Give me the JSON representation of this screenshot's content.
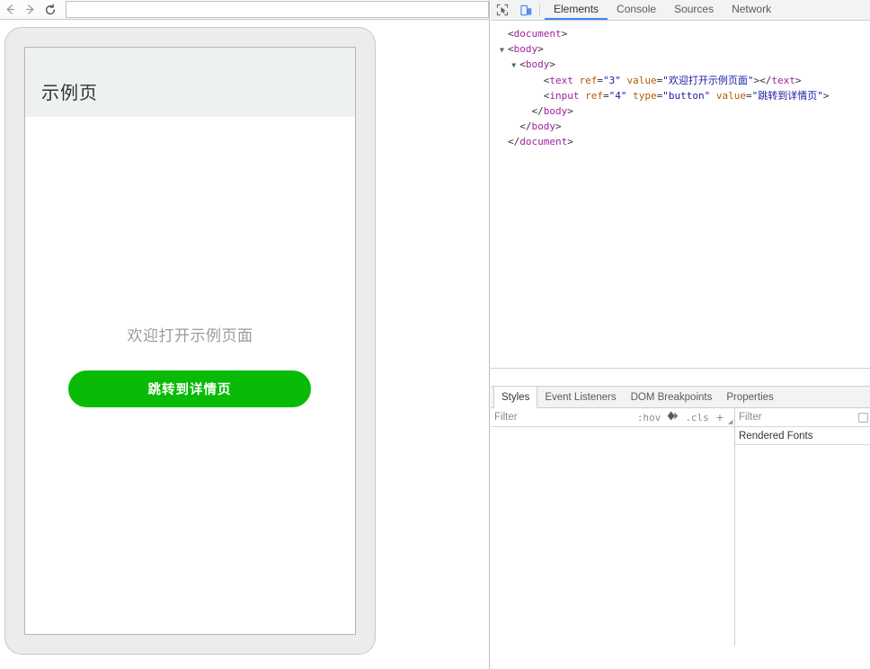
{
  "browser": {
    "nav": {
      "back_icon": "arrow-left-icon",
      "forward_icon": "arrow-right-icon",
      "reload_icon": "reload-icon"
    },
    "address_bar": {
      "value": "",
      "placeholder": ""
    }
  },
  "device_preview": {
    "page": {
      "header_title": "示例页",
      "welcome_text": "欢迎打开示例页面",
      "button_label": "跳转到详情页",
      "button_color": "#09bb07",
      "header_bg": "#edf1ef"
    }
  },
  "devtools": {
    "toolbar": {
      "inspect_icon": "inspect-element-icon",
      "device_toggle_icon": "device-toolbar-icon",
      "device_toggle_color": "#4285f4"
    },
    "tabs": [
      {
        "label": "Elements",
        "selected": true
      },
      {
        "label": "Console",
        "selected": false
      },
      {
        "label": "Sources",
        "selected": false
      },
      {
        "label": "Network",
        "selected": false
      }
    ],
    "dom_tree": [
      {
        "indent": 0,
        "triangle": "",
        "parts": [
          {
            "t": "punc",
            "s": "<"
          },
          {
            "t": "tag",
            "s": "document"
          },
          {
            "t": "punc",
            "s": ">"
          }
        ]
      },
      {
        "indent": 0,
        "triangle": "▼",
        "parts": [
          {
            "t": "punc",
            "s": "<"
          },
          {
            "t": "tag",
            "s": "body"
          },
          {
            "t": "punc",
            "s": ">"
          }
        ]
      },
      {
        "indent": 1,
        "triangle": "▼",
        "parts": [
          {
            "t": "punc",
            "s": "<"
          },
          {
            "t": "tag",
            "s": "body"
          },
          {
            "t": "punc",
            "s": ">"
          }
        ]
      },
      {
        "indent": 3,
        "triangle": "",
        "parts": [
          {
            "t": "punc",
            "s": "<"
          },
          {
            "t": "tag",
            "s": "text"
          },
          {
            "t": "punc",
            "s": " "
          },
          {
            "t": "attr",
            "s": "ref"
          },
          {
            "t": "punc",
            "s": "="
          },
          {
            "t": "val",
            "s": "\"3\""
          },
          {
            "t": "punc",
            "s": " "
          },
          {
            "t": "attr",
            "s": "value"
          },
          {
            "t": "punc",
            "s": "="
          },
          {
            "t": "val",
            "s": "\"欢迎打开示例页面\""
          },
          {
            "t": "punc",
            "s": ">"
          },
          {
            "t": "punc",
            "s": "</"
          },
          {
            "t": "tag",
            "s": "text"
          },
          {
            "t": "punc",
            "s": ">"
          }
        ]
      },
      {
        "indent": 3,
        "triangle": "",
        "parts": [
          {
            "t": "punc",
            "s": "<"
          },
          {
            "t": "tag",
            "s": "input"
          },
          {
            "t": "punc",
            "s": " "
          },
          {
            "t": "attr",
            "s": "ref"
          },
          {
            "t": "punc",
            "s": "="
          },
          {
            "t": "val",
            "s": "\"4\""
          },
          {
            "t": "punc",
            "s": " "
          },
          {
            "t": "attr",
            "s": "type"
          },
          {
            "t": "punc",
            "s": "="
          },
          {
            "t": "val",
            "s": "\"button\""
          },
          {
            "t": "punc",
            "s": " "
          },
          {
            "t": "attr",
            "s": "value"
          },
          {
            "t": "punc",
            "s": "="
          },
          {
            "t": "val",
            "s": "\"跳转到详情页\""
          },
          {
            "t": "punc",
            "s": ">"
          }
        ]
      },
      {
        "indent": 2,
        "triangle": "",
        "parts": [
          {
            "t": "punc",
            "s": "</"
          },
          {
            "t": "tag",
            "s": "body"
          },
          {
            "t": "punc",
            "s": ">"
          }
        ]
      },
      {
        "indent": 1,
        "triangle": "",
        "parts": [
          {
            "t": "punc",
            "s": "</"
          },
          {
            "t": "tag",
            "s": "body"
          },
          {
            "t": "punc",
            "s": ">"
          }
        ]
      },
      {
        "indent": 0,
        "triangle": "",
        "parts": [
          {
            "t": "punc",
            "s": "</"
          },
          {
            "t": "tag",
            "s": "document"
          },
          {
            "t": "punc",
            "s": ">"
          }
        ]
      }
    ],
    "sidebar_tabs": [
      {
        "label": "Styles",
        "selected": true
      },
      {
        "label": "Event Listeners",
        "selected": false
      },
      {
        "label": "DOM Breakpoints",
        "selected": false
      },
      {
        "label": "Properties",
        "selected": false
      }
    ],
    "styles_pane": {
      "filter_placeholder": "Filter",
      "filter_value": "",
      "hov_label": ":hov",
      "color_picker_icon": "diamond-icon",
      "cls_label": ".cls",
      "new_rule_label": "+"
    },
    "properties_pane": {
      "filter_placeholder": "Filter",
      "filter_value": "",
      "rendered_fonts_label": "Rendered Fonts"
    }
  }
}
